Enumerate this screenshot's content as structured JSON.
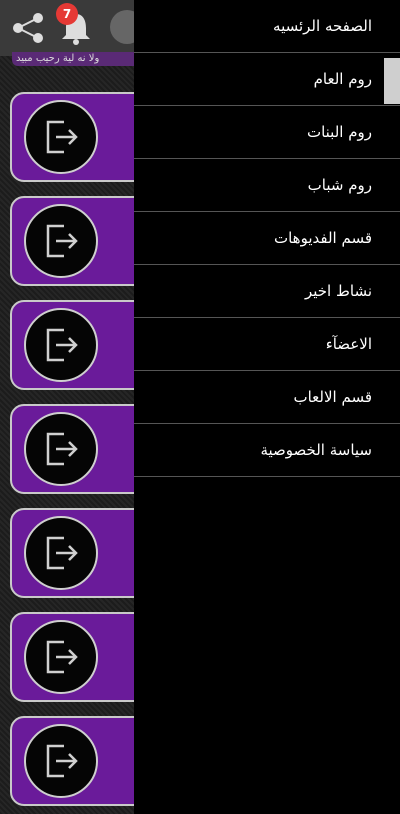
{
  "header": {
    "notification_count": "7",
    "ticker_text": "ولا نه لية رحيب مبيد"
  },
  "cards": [
    {
      "icon": "logout-icon"
    },
    {
      "icon": "logout-icon"
    },
    {
      "icon": "logout-icon"
    },
    {
      "icon": "logout-icon"
    },
    {
      "icon": "logout-icon"
    },
    {
      "icon": "logout-icon"
    },
    {
      "icon": "logout-icon"
    }
  ],
  "drawer": {
    "items": [
      {
        "label": "الصفحه الرئسيه"
      },
      {
        "label": "روم العام"
      },
      {
        "label": "روم البنات"
      },
      {
        "label": "روم شباب"
      },
      {
        "label": "قسم الفديوهات"
      },
      {
        "label": "نشاط اخير"
      },
      {
        "label": "الاعضآء"
      },
      {
        "label": "قسم الالعاب"
      },
      {
        "label": "سياسة الخصوصية"
      }
    ],
    "active_index": 1
  },
  "colors": {
    "card_purple": "#6a1b9a",
    "badge_red": "#e53935",
    "drawer_bg": "#000000"
  }
}
